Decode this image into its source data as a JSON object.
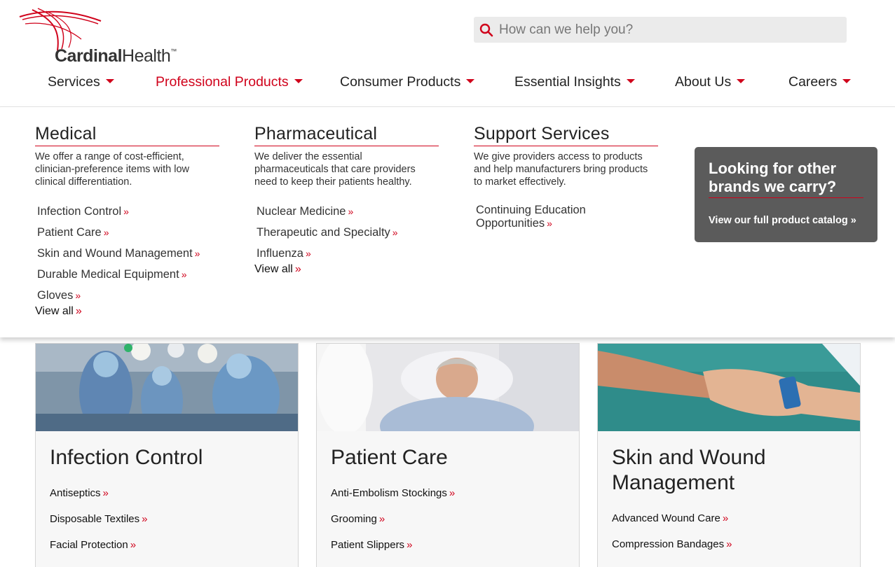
{
  "brand": {
    "logo_text_bold": "Cardinal",
    "logo_text": "Health",
    "trademark": "™"
  },
  "search": {
    "placeholder": "How can we help you?"
  },
  "nav": [
    {
      "label": "Services"
    },
    {
      "label": "Professional Products"
    },
    {
      "label": "Consumer Products"
    },
    {
      "label": "Essential Insights"
    },
    {
      "label": "About Us"
    },
    {
      "label": "Careers"
    }
  ],
  "accent_color": "#d0021b",
  "menu": {
    "medical": {
      "title": "Medical",
      "desc": "We offer a range of cost-efficient, clinician-preference items with low clinical differentiation.",
      "links": [
        "Infection Control",
        "Patient Care",
        "Skin and Wound Management",
        "Durable Medical Equipment",
        "Gloves"
      ],
      "view_all": "View all"
    },
    "pharma": {
      "title": "Pharmaceutical",
      "desc": "We deliver the essential pharmaceuticals that care providers need to keep their patients healthy.",
      "links": [
        "Nuclear Medicine",
        "Therapeutic and Specialty",
        "Influenza"
      ],
      "view_all": "View all"
    },
    "support": {
      "title": "Support Services",
      "desc": "We give providers access to products and help manufacturers bring products to market effectively.",
      "link": "Continuing Education Opportunities"
    },
    "catalog": {
      "title": "Looking for other brands we carry?",
      "link": "View our full product catalog"
    }
  },
  "chevron": "»",
  "cards": [
    {
      "title": "Infection Control",
      "links": [
        "Antiseptics",
        "Disposable Textiles",
        "Facial Protection"
      ]
    },
    {
      "title": "Patient Care",
      "links": [
        "Anti-Embolism Stockings",
        "Grooming",
        "Patient Slippers"
      ]
    },
    {
      "title": "Skin and Wound Management",
      "links": [
        "Advanced Wound Care",
        "Compression Bandages"
      ]
    }
  ]
}
